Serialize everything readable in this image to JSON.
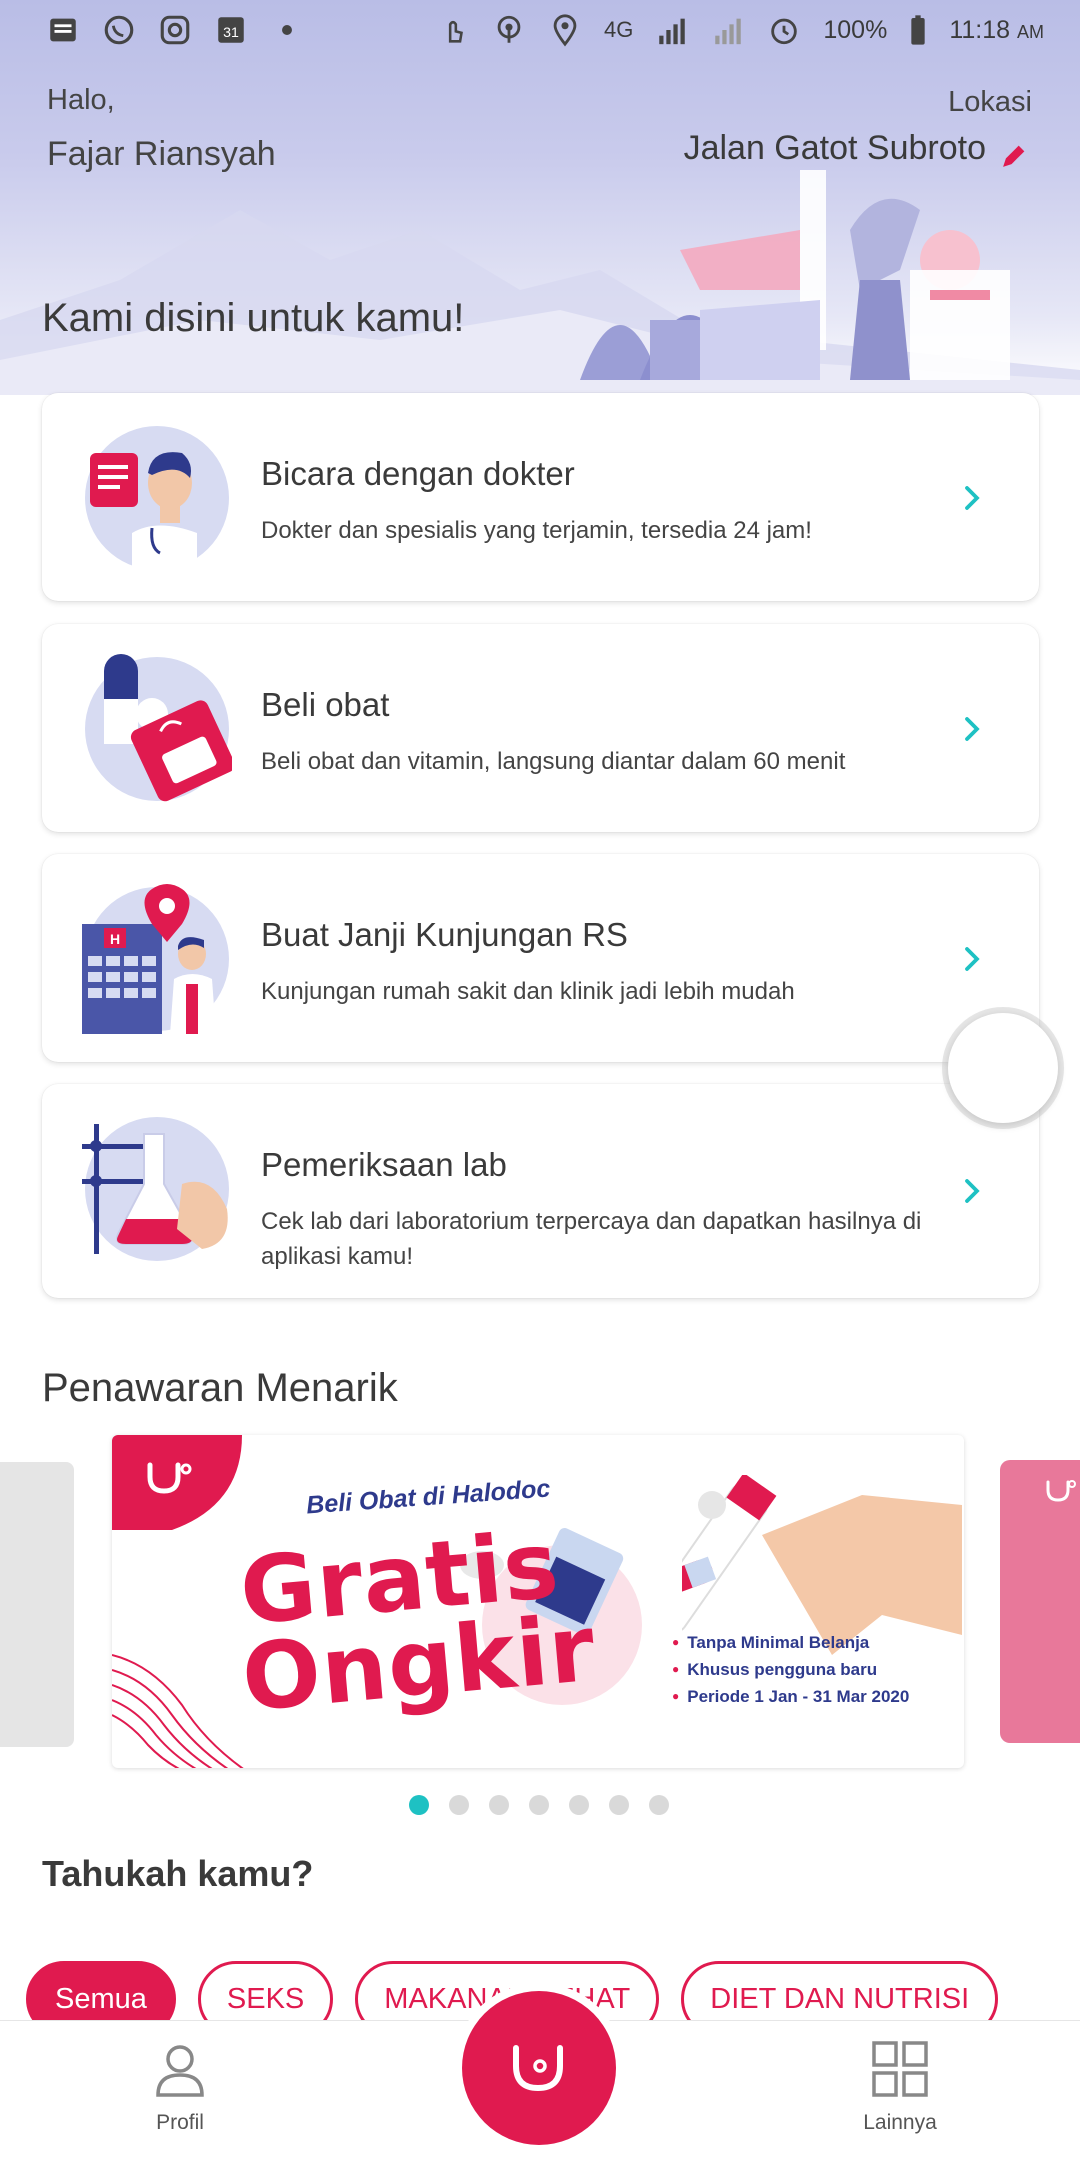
{
  "status_bar": {
    "battery": "100%",
    "time": "11:18",
    "ampm": "AM",
    "network": "4G"
  },
  "header": {
    "greeting": "Halo,",
    "user_name": "Fajar Riansyah",
    "location_label": "Lokasi",
    "location_value": "Jalan Gatot Subroto",
    "tagline": "Kami disini untuk kamu!"
  },
  "services": [
    {
      "title": "Bicara dengan dokter",
      "desc": "Dokter dan spesialis yang terjamin, tersedia 24 jam!"
    },
    {
      "title": "Beli obat",
      "desc": "Beli obat dan vitamin, langsung diantar dalam 60 menit"
    },
    {
      "title": "Buat Janji Kunjungan RS",
      "desc": "Kunjungan rumah sakit dan klinik jadi lebih mudah"
    },
    {
      "title": "Pemeriksaan lab",
      "desc": "Cek lab dari laboratorium terpercaya dan dapatkan hasilnya di aplikasi kamu!"
    }
  ],
  "offers": {
    "title": "Penawaran Menarik",
    "promo": {
      "subtitle": "Beli Obat di Halodoc",
      "headline_1": "Gratis",
      "headline_2": "Ongkir",
      "bullets": [
        "Tanpa Minimal Belanja",
        "Khusus pengguna baru",
        "Periode 1 Jan - 31 Mar 2020"
      ]
    },
    "page_count": 7,
    "active_page": 1
  },
  "did_you_know": {
    "title": "Tahukah kamu?",
    "chips": [
      "Semua",
      "SEKS",
      "MAKANAN SEHAT",
      "DIET DAN NUTRISI"
    ],
    "active_chip": 0
  },
  "bottom_nav": {
    "profile_label": "Profil",
    "more_label": "Lainnya"
  },
  "colors": {
    "brand": "#e01a4f",
    "accent": "#1ec1c3",
    "hero_bg": "#c3c6ea"
  }
}
